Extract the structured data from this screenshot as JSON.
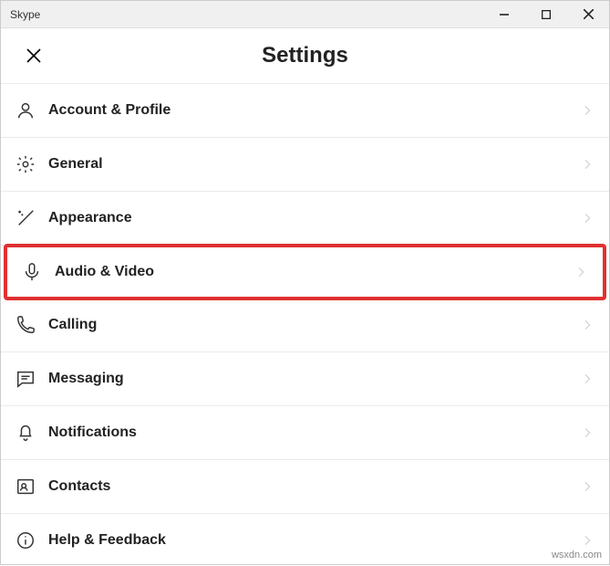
{
  "window": {
    "title": "Skype"
  },
  "header": {
    "title": "Settings"
  },
  "items": {
    "account": "Account & Profile",
    "general": "General",
    "appearance": "Appearance",
    "audiovideo": "Audio & Video",
    "calling": "Calling",
    "messaging": "Messaging",
    "notifications": "Notifications",
    "contacts": "Contacts",
    "help": "Help & Feedback"
  },
  "footer": {
    "watermark": "wsxdn.com"
  }
}
